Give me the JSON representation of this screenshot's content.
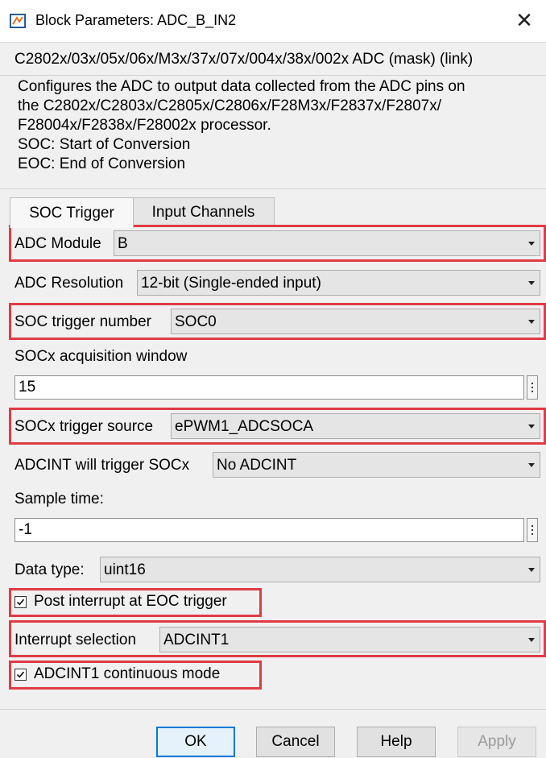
{
  "window": {
    "title": "Block Parameters: ADC_B_IN2",
    "icon": "simulink-block-icon",
    "close_icon": "close-icon"
  },
  "mask_header": "C2802x/03x/05x/06x/M3x/37x/07x/004x/38x/002x ADC (mask) (link)",
  "description": [
    "Configures the ADC to output data collected from the ADC pins on",
    "the C2802x/C2803x/C2805x/C2806x/F28M3x/F2837x/F2807x/",
    "F28004x/F2838x/F28002x processor.",
    "SOC: Start of Conversion",
    "EOC: End of Conversion"
  ],
  "tabs": [
    {
      "label": "SOC Trigger",
      "active": true
    },
    {
      "label": "Input Channels",
      "active": false
    }
  ],
  "params": {
    "adc_module": {
      "label": "ADC Module",
      "value": "B"
    },
    "adc_resolution": {
      "label": "ADC Resolution",
      "value": "12-bit (Single-ended input)"
    },
    "soc_trigger_number": {
      "label": "SOC trigger number",
      "value": "SOC0"
    },
    "socx_acq_window": {
      "label": "SOCx acquisition window",
      "value": "15"
    },
    "socx_trigger_source": {
      "label": "SOCx trigger source",
      "value": "ePWM1_ADCSOCA"
    },
    "adcint_trigger": {
      "label": "ADCINT will trigger SOCx",
      "value": "No ADCINT"
    },
    "sample_time": {
      "label": "Sample time:",
      "value": "-1"
    },
    "data_type": {
      "label": "Data type:",
      "value": "uint16"
    },
    "post_interrupt": {
      "label": "Post interrupt at EOC trigger",
      "checked": true
    },
    "interrupt_selection": {
      "label": "Interrupt selection",
      "value": "ADCINT1"
    },
    "continuous_mode": {
      "label": "ADCINT1 continuous mode",
      "checked": true
    }
  },
  "buttons": {
    "ok": "OK",
    "cancel": "Cancel",
    "help": "Help",
    "apply": "Apply"
  },
  "colors": {
    "highlight": "#e03b44",
    "default_button_border": "#0078d7"
  }
}
